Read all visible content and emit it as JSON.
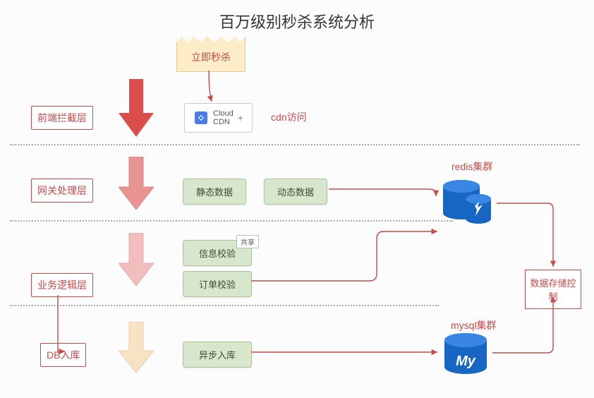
{
  "title": "百万级别秒杀系统分析",
  "note": {
    "label": "立即秒杀"
  },
  "layers": {
    "frontend": "前端拦截层",
    "gateway": "网关处理层",
    "business": "业务逻辑层",
    "db": "DB入库"
  },
  "cdn": {
    "line1": "Cloud",
    "line2": "CDN",
    "label": "cdn访问",
    "plus": "+"
  },
  "gatewayBoxes": {
    "static": "静态数据",
    "dynamic": "动态数据"
  },
  "businessBoxes": {
    "info": "信息校验",
    "order": "订单校验",
    "tag": "共享"
  },
  "dbBox": {
    "async": "异步入库"
  },
  "cluster": {
    "redis": "redis集群",
    "mysql": "mysql集群",
    "mysqlBadge": "My"
  },
  "storage": "数据存储控制"
}
